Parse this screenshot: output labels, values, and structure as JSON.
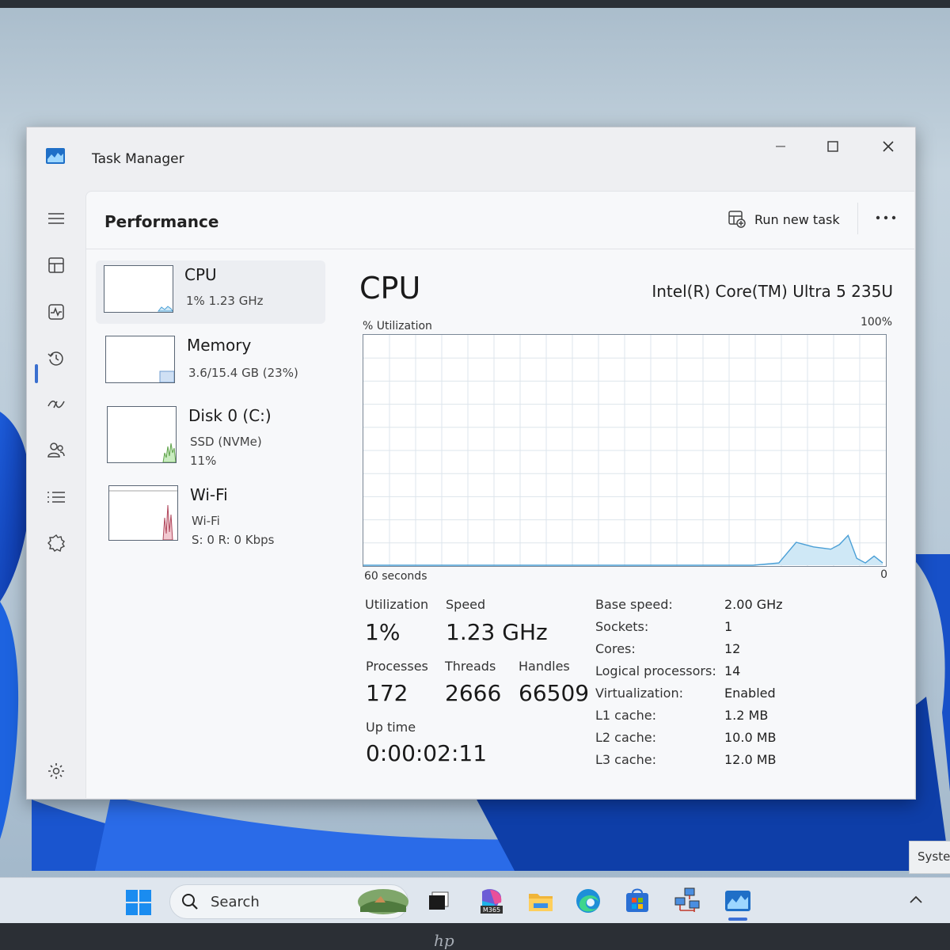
{
  "window": {
    "title": "Task Manager"
  },
  "page": {
    "title": "Performance",
    "run_new_task": "Run new task"
  },
  "devices": [
    {
      "name": "CPU",
      "sub1": "1%  1.23 GHz",
      "sub2": ""
    },
    {
      "name": "Memory",
      "sub1": "3.6/15.4 GB (23%)",
      "sub2": ""
    },
    {
      "name": "Disk 0 (C:)",
      "sub1": "SSD (NVMe)",
      "sub2": "11%"
    },
    {
      "name": "Wi-Fi",
      "sub1": "Wi-Fi",
      "sub2": "S: 0  R: 0 Kbps"
    }
  ],
  "cpu": {
    "heading": "CPU",
    "model": "Intel(R) Core(TM) Ultra 5 235U",
    "util_label": "% Utilization",
    "max_label": "100%",
    "x_label": "60 seconds",
    "zero_label": "0"
  },
  "stats": {
    "utilization_label": "Utilization",
    "utilization": "1%",
    "speed_label": "Speed",
    "speed": "1.23 GHz",
    "processes_label": "Processes",
    "processes": "172",
    "threads_label": "Threads",
    "threads": "2666",
    "handles_label": "Handles",
    "handles": "66509",
    "uptime_label": "Up time",
    "uptime": "0:00:02:11"
  },
  "specs": [
    {
      "key": "Base speed:",
      "value": "2.00 GHz"
    },
    {
      "key": "Sockets:",
      "value": "1"
    },
    {
      "key": "Cores:",
      "value": "12"
    },
    {
      "key": "Logical processors:",
      "value": "14"
    },
    {
      "key": "Virtualization:",
      "value": "Enabled"
    },
    {
      "key": "L1 cache:",
      "value": "1.2 MB"
    },
    {
      "key": "L2 cache:",
      "value": "10.0 MB"
    },
    {
      "key": "L3 cache:",
      "value": "12.0 MB"
    }
  ],
  "chart_data": {
    "type": "area",
    "x": [
      0,
      5,
      10,
      15,
      20,
      25,
      30,
      35,
      40,
      45,
      48,
      50,
      52,
      54,
      55,
      56,
      57,
      58,
      59,
      60
    ],
    "values": [
      0,
      0,
      0,
      0,
      0,
      0,
      0,
      0,
      0,
      0,
      1,
      10,
      8,
      7,
      9,
      13,
      3,
      1,
      4,
      1
    ],
    "xlabel": "60 seconds",
    "ylabel": "% Utilization",
    "ylim": [
      0,
      100
    ]
  },
  "taskbar": {
    "search_text": "Search",
    "m365_label": "M365",
    "tooltip_text": "Syste"
  },
  "colors": {
    "accent": "#3a6fcf",
    "graph_line": "#4a9fd6",
    "graph_fill": "#cfe8f6",
    "grid": "#dde5ec"
  }
}
